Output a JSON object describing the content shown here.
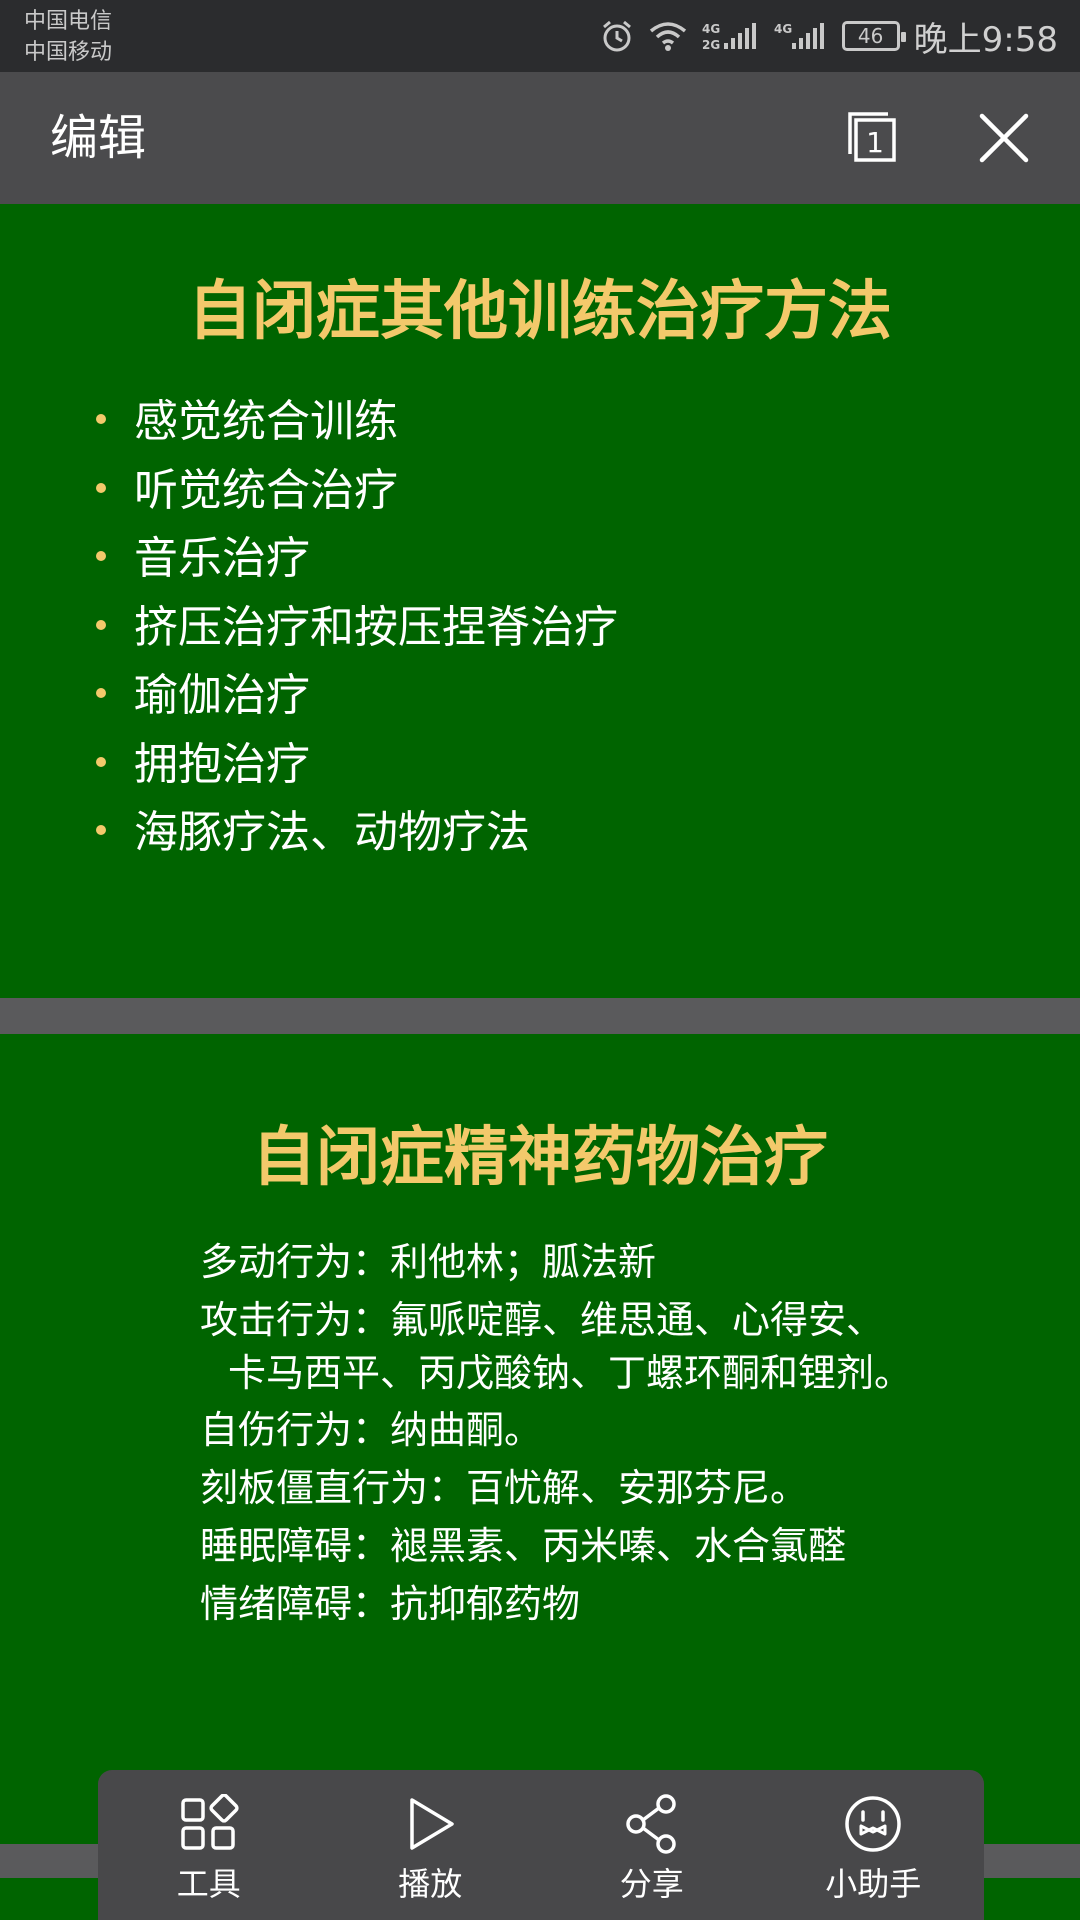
{
  "status_bar": {
    "carrier_1": "中国电信",
    "carrier_2": "中国移动",
    "battery": "46",
    "time": "晚上9:58",
    "icons": [
      "alarm-icon",
      "wifi-icon",
      "signal-4g2g-icon",
      "signal-4g-icon",
      "battery-icon"
    ]
  },
  "app_bar": {
    "title": "编辑",
    "page_count": "1",
    "icons": [
      "pages-icon",
      "close-icon"
    ]
  },
  "slide1": {
    "title": "自闭症其他训练治疗方法",
    "bullets": [
      "感觉统合训练",
      "听觉统合治疗",
      "音乐治疗",
      "挤压治疗和按压捏脊治疗",
      "瑜伽治疗",
      "拥抱治疗",
      "海豚疗法、动物疗法"
    ]
  },
  "slide2": {
    "title": "自闭症精神药物治疗",
    "lines": [
      "多动行为：利他林；胍法新",
      "攻击行为：氟哌啶醇、维思通、心得安、",
      "卡马西平、丙戊酸钠、丁螺环酮和锂剂。",
      "自伤行为：纳曲酮。",
      "刻板僵直行为：百忧解、安那芬尼。",
      "睡眠障碍：褪黑素、丙米嗪、水合氯醛",
      "情绪障碍：抗抑郁药物"
    ]
  },
  "bottom_bar": {
    "tools": [
      {
        "label": "工具",
        "icon": "tools-icon"
      },
      {
        "label": "播放",
        "icon": "play-icon"
      },
      {
        "label": "分享",
        "icon": "share-icon"
      },
      {
        "label": "小助手",
        "icon": "assistant-icon"
      }
    ]
  },
  "colors": {
    "slide_bg": "#006400",
    "title_color": "#f3c96b",
    "app_bar_bg": "#4b4b4d",
    "status_bar_bg": "#2b2c2e"
  }
}
